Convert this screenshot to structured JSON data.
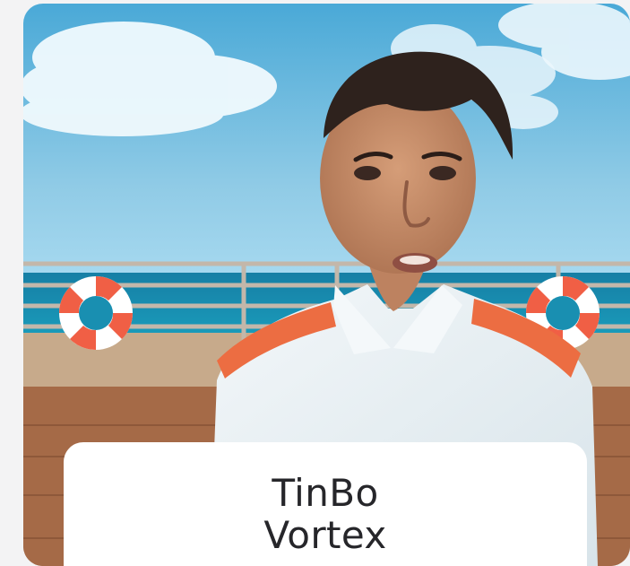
{
  "hero": {
    "scene_description_icon": "ship-deck-presenter-illustration",
    "colors": {
      "sky_top": "#4aa9d7",
      "sky_bottom": "#a5d8ef",
      "sea": "#148fb0",
      "deck": "#a96d46",
      "shirt": "#e7f0f4",
      "shirt_accent": "#ec6d42",
      "lifebuoy": "#ffffff",
      "lifebuoy_stripe": "#f05f45"
    }
  },
  "caption": {
    "line_1": "TinBo",
    "line_2": "Vortex"
  }
}
